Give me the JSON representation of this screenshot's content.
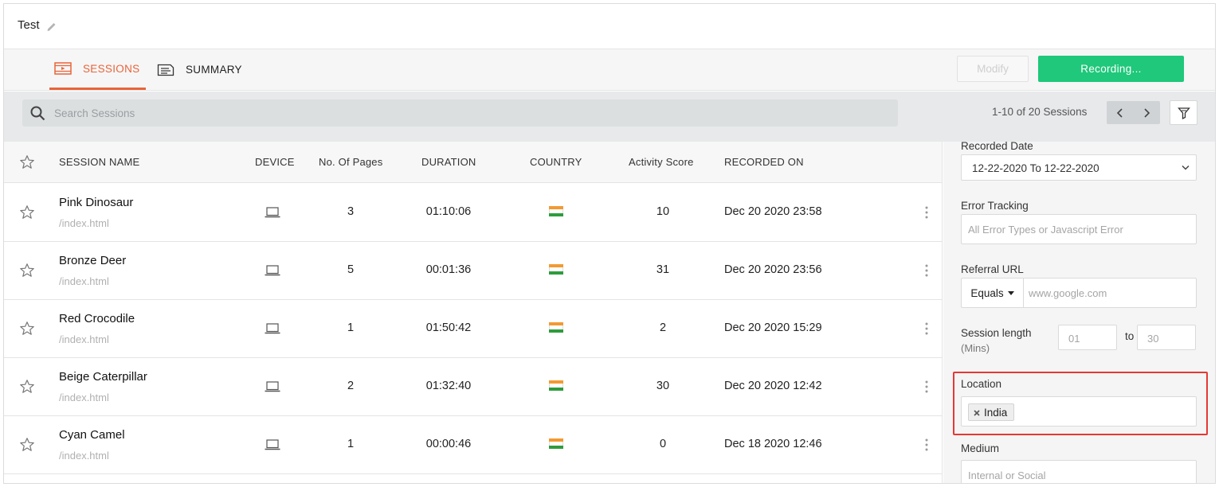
{
  "header": {
    "title": "Test"
  },
  "tabs": [
    {
      "label": "SESSIONS",
      "active": true
    },
    {
      "label": "SUMMARY",
      "active": false
    }
  ],
  "actions": {
    "modify_label": "Modify",
    "recording_label": "Recording..."
  },
  "search": {
    "placeholder": "Search Sessions"
  },
  "pagination": {
    "text": "1-10 of 20 Sessions"
  },
  "table": {
    "columns": [
      "SESSION NAME",
      "DEVICE",
      "No. Of Pages",
      "DURATION",
      "COUNTRY",
      "Activity Score",
      "RECORDED ON"
    ],
    "rows": [
      {
        "name": "Pink Dinosaur",
        "path": "/index.html",
        "pages": "3",
        "duration": "01:10:06",
        "score": "10",
        "recorded": "Dec 20 2020 23:58"
      },
      {
        "name": "Bronze Deer",
        "path": "/index.html",
        "pages": "5",
        "duration": "00:01:36",
        "score": "31",
        "recorded": "Dec 20 2020 23:56"
      },
      {
        "name": "Red Crocodile",
        "path": "/index.html",
        "pages": "1",
        "duration": "01:50:42",
        "score": "2",
        "recorded": "Dec 20 2020 15:29"
      },
      {
        "name": "Beige Caterpillar",
        "path": "/index.html",
        "pages": "2",
        "duration": "01:32:40",
        "score": "30",
        "recorded": "Dec 20 2020 12:42"
      },
      {
        "name": "Cyan Camel",
        "path": "/index.html",
        "pages": "1",
        "duration": "00:00:46",
        "score": "0",
        "recorded": "Dec 18 2020 12:46"
      }
    ]
  },
  "filters": {
    "recorded_date": {
      "label": "Recorded Date",
      "value": "12-22-2020 To 12-22-2020"
    },
    "error_tracking": {
      "label": "Error Tracking",
      "placeholder": "All Error Types or Javascript Error"
    },
    "referral_url": {
      "label": "Referral URL",
      "operator": "Equals",
      "placeholder": "www.google.com"
    },
    "session_length": {
      "label": "Session length",
      "unit": "(Mins)",
      "from_placeholder": "01",
      "separator": "to",
      "to_placeholder": "30"
    },
    "location": {
      "label": "Location",
      "chip": "India"
    },
    "medium": {
      "label": "Medium",
      "placeholder": "Internal or Social"
    }
  },
  "colors": {
    "accent": "#e8643a",
    "recording": "#1fc87a",
    "highlight": "#e53935"
  }
}
